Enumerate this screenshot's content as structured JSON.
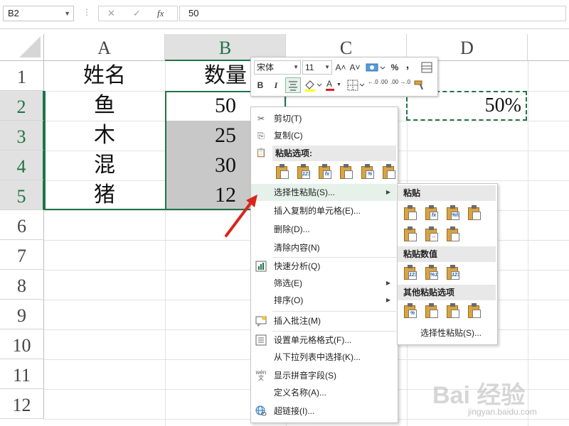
{
  "formula_bar": {
    "name_box": "B2",
    "menu_dots": "⋮",
    "cancel_glyph": "✕",
    "enter_glyph": "✓",
    "fx_glyph": "fx",
    "value": "50"
  },
  "columns": [
    "A",
    "B",
    "C",
    "D"
  ],
  "rows": [
    "1",
    "2",
    "3",
    "4",
    "5",
    "6",
    "7",
    "8",
    "9",
    "10",
    "11",
    "12"
  ],
  "cells": {
    "A1": "姓名",
    "B1": "数量",
    "A2": "鱼",
    "B2": "50",
    "A3": "木",
    "B3": "25",
    "A4": "混",
    "B4": "30",
    "A5": "猪",
    "B5": "12",
    "D2": "50%"
  },
  "mini_toolbar": {
    "font_name": "宋体",
    "font_size": "11",
    "grow_font": "A˄",
    "shrink_font": "A˅",
    "percent": "%",
    "comma": ",",
    "bold": "B",
    "italic": "I",
    "font_color_letter": "A",
    "increase_decimal": "←.0 .00",
    "decrease_decimal": ".00 →.0"
  },
  "context_menu": {
    "cut": "剪切(T)",
    "copy": "复制(C)",
    "paste_options": "粘贴选项:",
    "paste_special": "选择性粘贴(S)...",
    "insert_copied": "插入复制的单元格(E)...",
    "delete": "删除(D)...",
    "clear": "清除内容(N)",
    "quick_analysis": "快速分析(Q)",
    "filter": "筛选(E)",
    "sort": "排序(O)",
    "insert_comment": "插入批注(M)",
    "format_cells": "设置单元格格式(F)...",
    "pick_list": "从下拉列表中选择(K)...",
    "phonetic": "显示拼音字段(S)",
    "define_name": "定义名称(A)...",
    "hyperlink": "超链接(I)...",
    "phonetic_icon_top": "wén",
    "phonetic_icon_bottom": "文",
    "paste_icon_labels": [
      "",
      "123",
      "fx",
      "",
      "%",
      ""
    ]
  },
  "submenu": {
    "paste_header": "粘贴",
    "paste_values_header": "粘贴数值",
    "other_header": "其他粘贴选项",
    "paste_special": "选择性粘贴(S)...",
    "paste_icons": [
      "",
      "fx",
      "%fx",
      "",
      "",
      "↔",
      ""
    ],
    "value_icons": [
      "123",
      "%123",
      "123"
    ],
    "other_icons": [
      "%",
      "",
      "",
      ""
    ]
  },
  "watermark": {
    "text": "Bai 经验",
    "sub": "jingyan.baidu.com"
  },
  "colors": {
    "excel_green": "#217346",
    "selection_gray": "#c8c8c8",
    "arrow_red": "#d9261c"
  }
}
